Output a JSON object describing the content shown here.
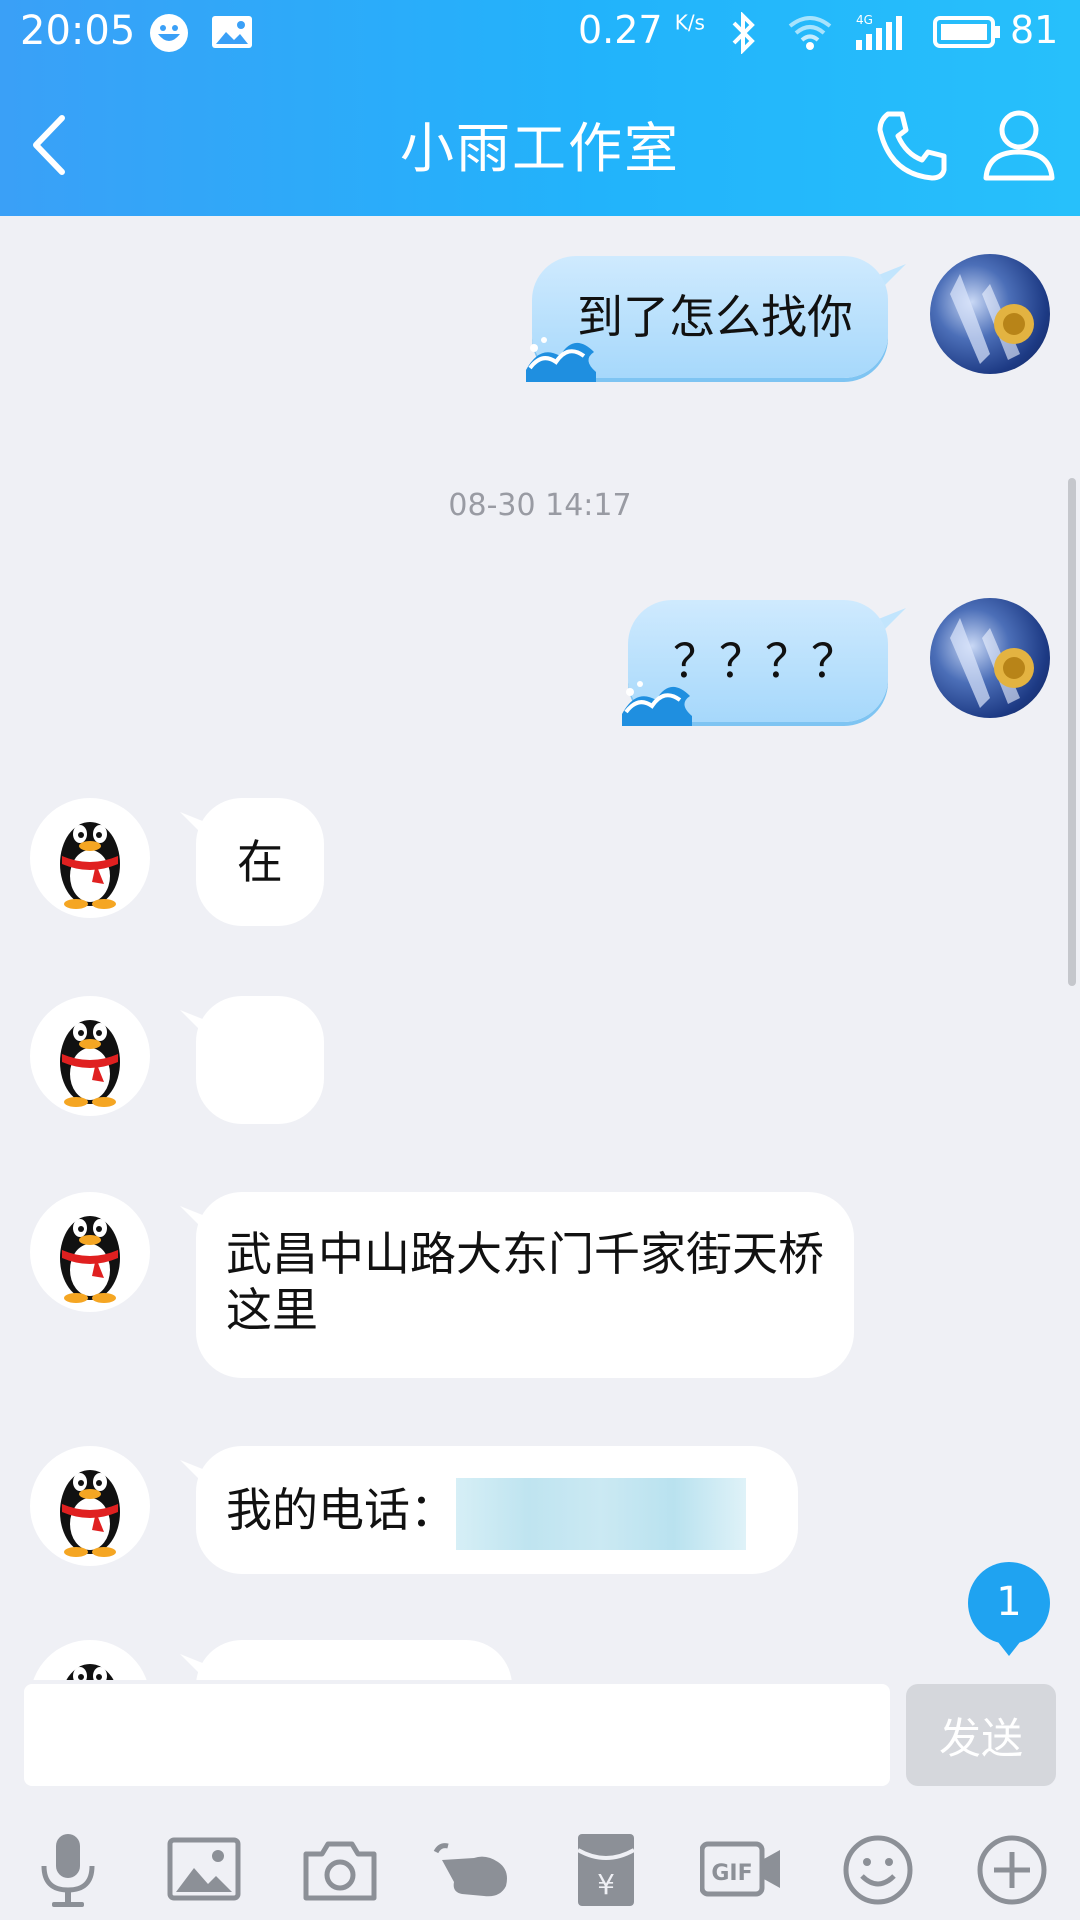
{
  "status_bar": {
    "time": "20:05",
    "speed": "0.27",
    "speed_unit": "K/s",
    "network": "4G",
    "battery": "81"
  },
  "header": {
    "title": "小雨工作室",
    "back_icon": "back-arrow-icon",
    "call_icon": "phone-icon",
    "profile_icon": "person-icon"
  },
  "chat": {
    "timestamp": "08-30 14:17",
    "messages": [
      {
        "from": "self",
        "text": "到了怎么找你"
      },
      {
        "from": "self",
        "text": "？？？？"
      },
      {
        "from": "other",
        "text": "在"
      },
      {
        "from": "other",
        "text": ""
      },
      {
        "from": "other",
        "text": "武昌中山路大东门千家街天桥这里"
      },
      {
        "from": "other",
        "text": "我的电话："
      }
    ],
    "unread_badge": "1"
  },
  "input": {
    "placeholder": "",
    "send_label": "发送"
  },
  "toolbar": {
    "items": [
      "microphone-icon",
      "image-icon",
      "camera-icon",
      "poke-hand-icon",
      "red-packet-icon",
      "gif-icon",
      "emoji-icon",
      "plus-icon"
    ]
  },
  "colors": {
    "header_gradient_start": "#3aa0f7",
    "header_gradient_end": "#27c0fb",
    "outgoing_bubble": "#b8e0fc",
    "incoming_bubble": "#ffffff",
    "chat_background": "#eff0f5",
    "badge": "#1fa3f1"
  }
}
